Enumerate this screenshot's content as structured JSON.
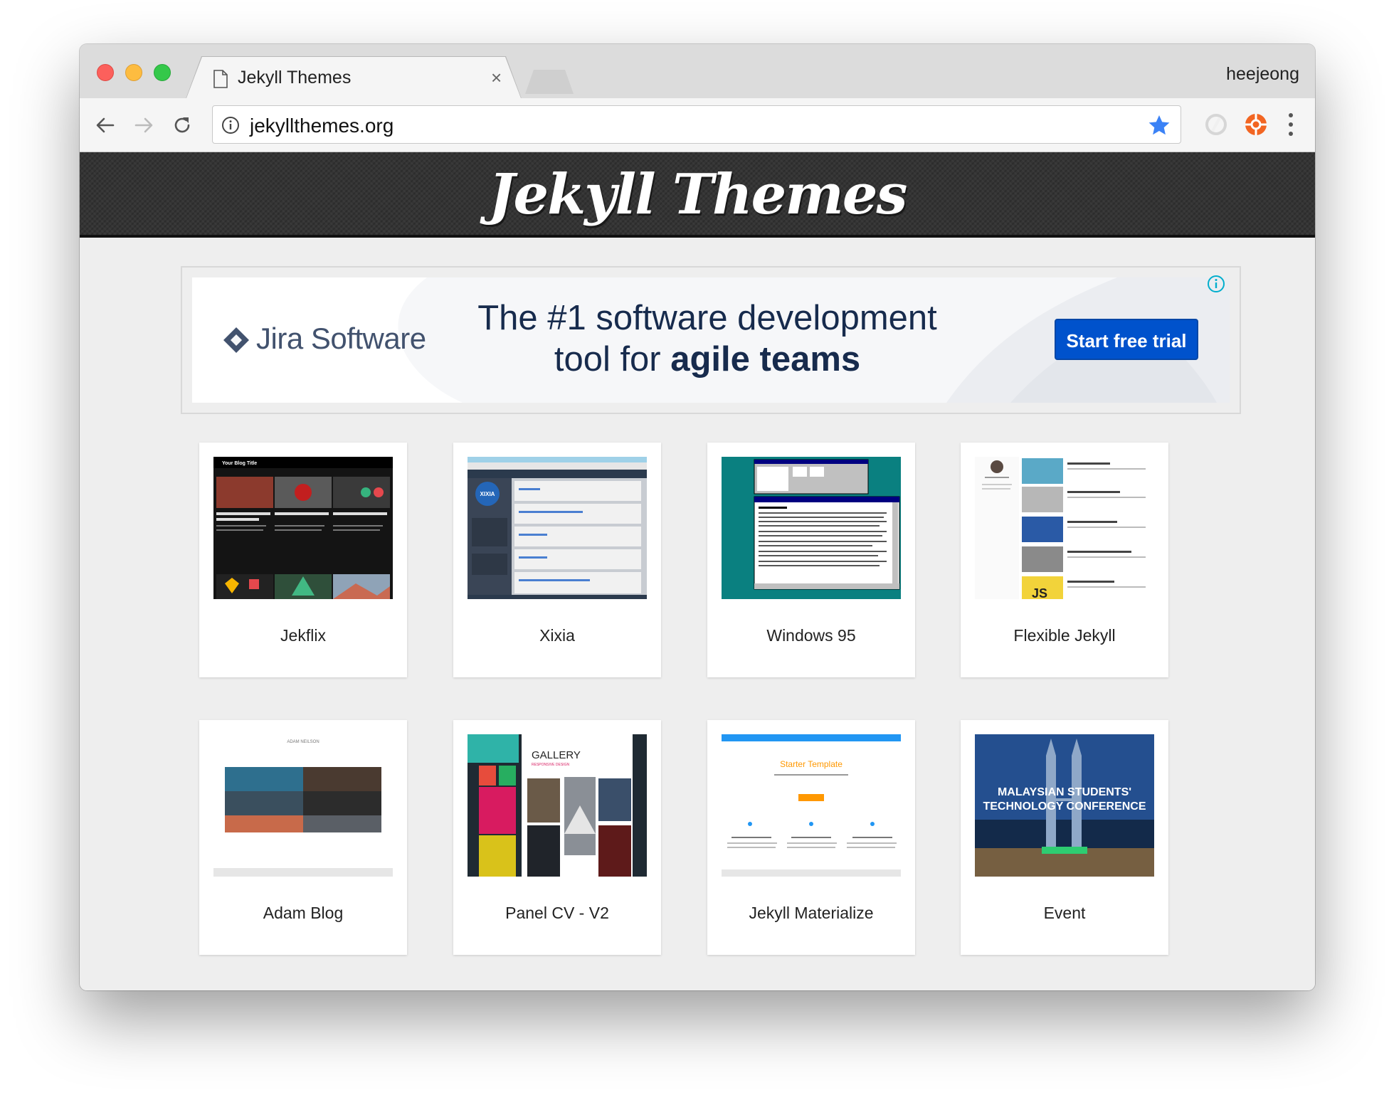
{
  "browser": {
    "tab_title": "Jekyll Themes",
    "tab_close": "×",
    "profile_name": "heejeong",
    "url": "jekyllthemes.org"
  },
  "site": {
    "title": "Jekyll Themes"
  },
  "ad": {
    "brand": "Jira Software",
    "headline_line1": "The #1 software development",
    "headline_line2_prefix": "tool for ",
    "headline_line2_bold": "agile teams",
    "cta": "Start free trial"
  },
  "themes": [
    {
      "name": "Jekflix",
      "thumb_text": [
        "Your Blog Title"
      ]
    },
    {
      "name": "Xixia",
      "thumb_text": [
        "XIXIA"
      ]
    },
    {
      "name": "Windows 95",
      "thumb_text": []
    },
    {
      "name": "Flexible Jekyll",
      "thumb_text": [
        "JS"
      ]
    },
    {
      "name": "Adam Blog",
      "thumb_text": [
        "ADAM NEILSON"
      ]
    },
    {
      "name": "Panel CV - V2",
      "thumb_text": [
        "GALLERY",
        "RESPONSIVE DESIGN"
      ]
    },
    {
      "name": "Jekyll Materialize",
      "thumb_text": [
        "Starter Template"
      ]
    },
    {
      "name": "Event",
      "thumb_text": [
        "MALAYSIAN STUDENTS'",
        "TECHNOLOGY CONFERENCE"
      ]
    }
  ],
  "colors": {
    "ad_cta": "#0052cc",
    "header_bg": "#343434",
    "page_bg": "#eeeeee",
    "bookmark_star": "#3b82f6",
    "extension_orange": "#f26522"
  }
}
